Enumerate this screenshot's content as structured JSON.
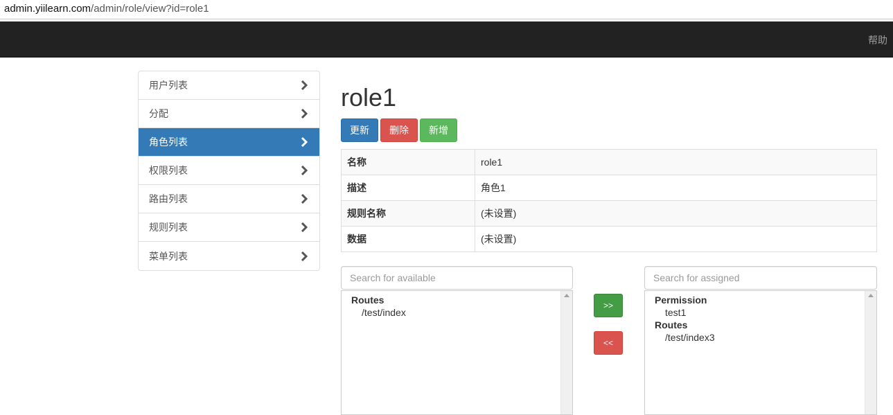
{
  "browser": {
    "url_host": "admin.yiilearn.com",
    "url_path": "/admin/role/view?id=role1"
  },
  "navbar": {
    "help": "帮助"
  },
  "sidebar": {
    "items": [
      {
        "label": "用户列表",
        "active": false
      },
      {
        "label": "分配",
        "active": false
      },
      {
        "label": "角色列表",
        "active": true
      },
      {
        "label": "权限列表",
        "active": false
      },
      {
        "label": "路由列表",
        "active": false
      },
      {
        "label": "规则列表",
        "active": false
      },
      {
        "label": "菜单列表",
        "active": false
      }
    ]
  },
  "main": {
    "title": "role1",
    "buttons": {
      "update": "更新",
      "delete": "删除",
      "create": "新增"
    },
    "detail": [
      {
        "key": "名称",
        "value": "role1"
      },
      {
        "key": "描述",
        "value": "角色1"
      },
      {
        "key": "规则名称",
        "value": "(未设置)"
      },
      {
        "key": "数据",
        "value": "(未设置)"
      }
    ],
    "available": {
      "placeholder": "Search for available",
      "groups": [
        {
          "label": "Routes",
          "options": [
            "/test/index"
          ]
        }
      ]
    },
    "assigned": {
      "placeholder": "Search for assigned",
      "groups": [
        {
          "label": "Permission",
          "options": [
            "test1"
          ]
        },
        {
          "label": "Routes",
          "options": [
            "/test/index3"
          ]
        }
      ]
    },
    "move": {
      "assign": ">>",
      "remove": "<<"
    }
  },
  "colors": {
    "navbar": "#222222",
    "primary": "#337ab7",
    "danger": "#d9534f",
    "success": "#5cb85c"
  }
}
